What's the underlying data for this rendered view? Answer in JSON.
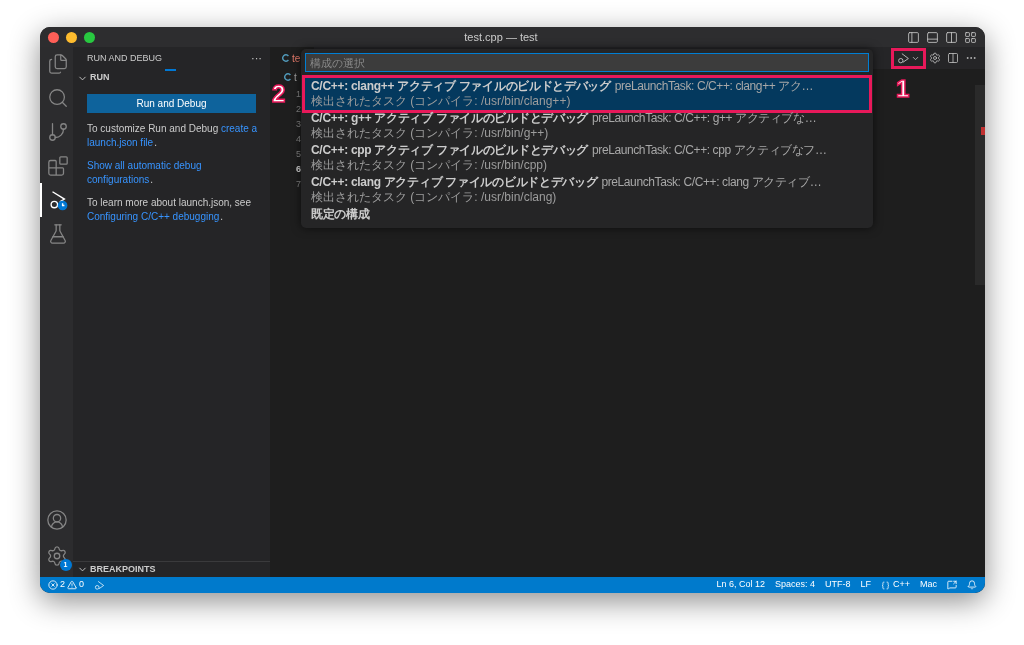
{
  "window": {
    "title": "test.cpp — test"
  },
  "activity_bar": {
    "items": [
      {
        "kind": "explorer",
        "selected": false
      },
      {
        "kind": "search",
        "selected": false
      },
      {
        "kind": "source-control",
        "selected": false
      },
      {
        "kind": "extensions",
        "selected": false
      },
      {
        "kind": "run-debug",
        "selected": true
      },
      {
        "kind": "testing",
        "selected": false
      }
    ],
    "settings_badge": "1"
  },
  "sidebar": {
    "title": "RUN AND DEBUG",
    "more": "···",
    "section": "RUN",
    "button": "Run and Debug",
    "paragraphs": [
      [
        [
          {
            "t": "To customize Run and Debug ",
            "link": false
          },
          {
            "t": "create a",
            "link": true
          }
        ],
        [
          {
            "t": "launch.json file",
            "link": true
          },
          {
            "t": ".",
            "link": false
          }
        ]
      ],
      [
        [
          {
            "t": "Show all automatic debug",
            "link": true
          }
        ],
        [
          {
            "t": "configurations",
            "link": true
          },
          {
            "t": ".",
            "link": false
          }
        ]
      ],
      [
        [
          {
            "t": "To learn more about launch.json, see",
            "link": false
          }
        ],
        [
          {
            "t": "Configuring C/C++ debugging",
            "link": true
          },
          {
            "t": ".",
            "link": false
          }
        ]
      ]
    ],
    "breakpoints": "BREAKPOINTS"
  },
  "editor": {
    "tab": "te",
    "breadcrumb": "t",
    "callout": "1",
    "lines": [
      {
        "n": "1",
        "current": false
      },
      {
        "n": "2",
        "current": false
      },
      {
        "n": "3",
        "current": false
      },
      {
        "n": "4",
        "current": false
      },
      {
        "n": "5",
        "current": false
      },
      {
        "n": "6",
        "current": true
      },
      {
        "n": "7",
        "current": false
      }
    ]
  },
  "quick_pick": {
    "placeholder": "構成の選択",
    "callout": "2",
    "items": [
      {
        "label": "C/C++: clang++ アクティブ ファイルのビルドとデバッグ",
        "description": "preLaunchTask: C/C++: clang++ アク…",
        "detail": "検出されたタスク (コンパイラ: /usr/bin/clang++)",
        "selected": true
      },
      {
        "label": "C/C++: g++ アクティブ ファイルのビルドとデバッグ",
        "description": "preLaunchTask: C/C++: g++ アクティブな…",
        "detail": "検出されたタスク (コンパイラ: /usr/bin/g++)",
        "selected": false
      },
      {
        "label": "C/C++: cpp アクティブ ファイルのビルドとデバッグ",
        "description": "preLaunchTask: C/C++: cpp アクティブなフ…",
        "detail": "検出されたタスク (コンパイラ: /usr/bin/cpp)",
        "selected": false
      },
      {
        "label": "C/C++: clang アクティブ ファイルのビルドとデバッグ",
        "description": "preLaunchTask: C/C++: clang アクティブ…",
        "detail": "検出されたタスク (コンパイラ: /usr/bin/clang)",
        "selected": false
      },
      {
        "label": "既定の構成",
        "selected": false
      }
    ]
  },
  "status_bar": {
    "errors": "2",
    "warnings": "0",
    "items": [
      "Ln 6, Col 12",
      "Spaces: 4",
      "UTF-8",
      "LF"
    ],
    "language": "C++",
    "eol_os": "Mac"
  }
}
